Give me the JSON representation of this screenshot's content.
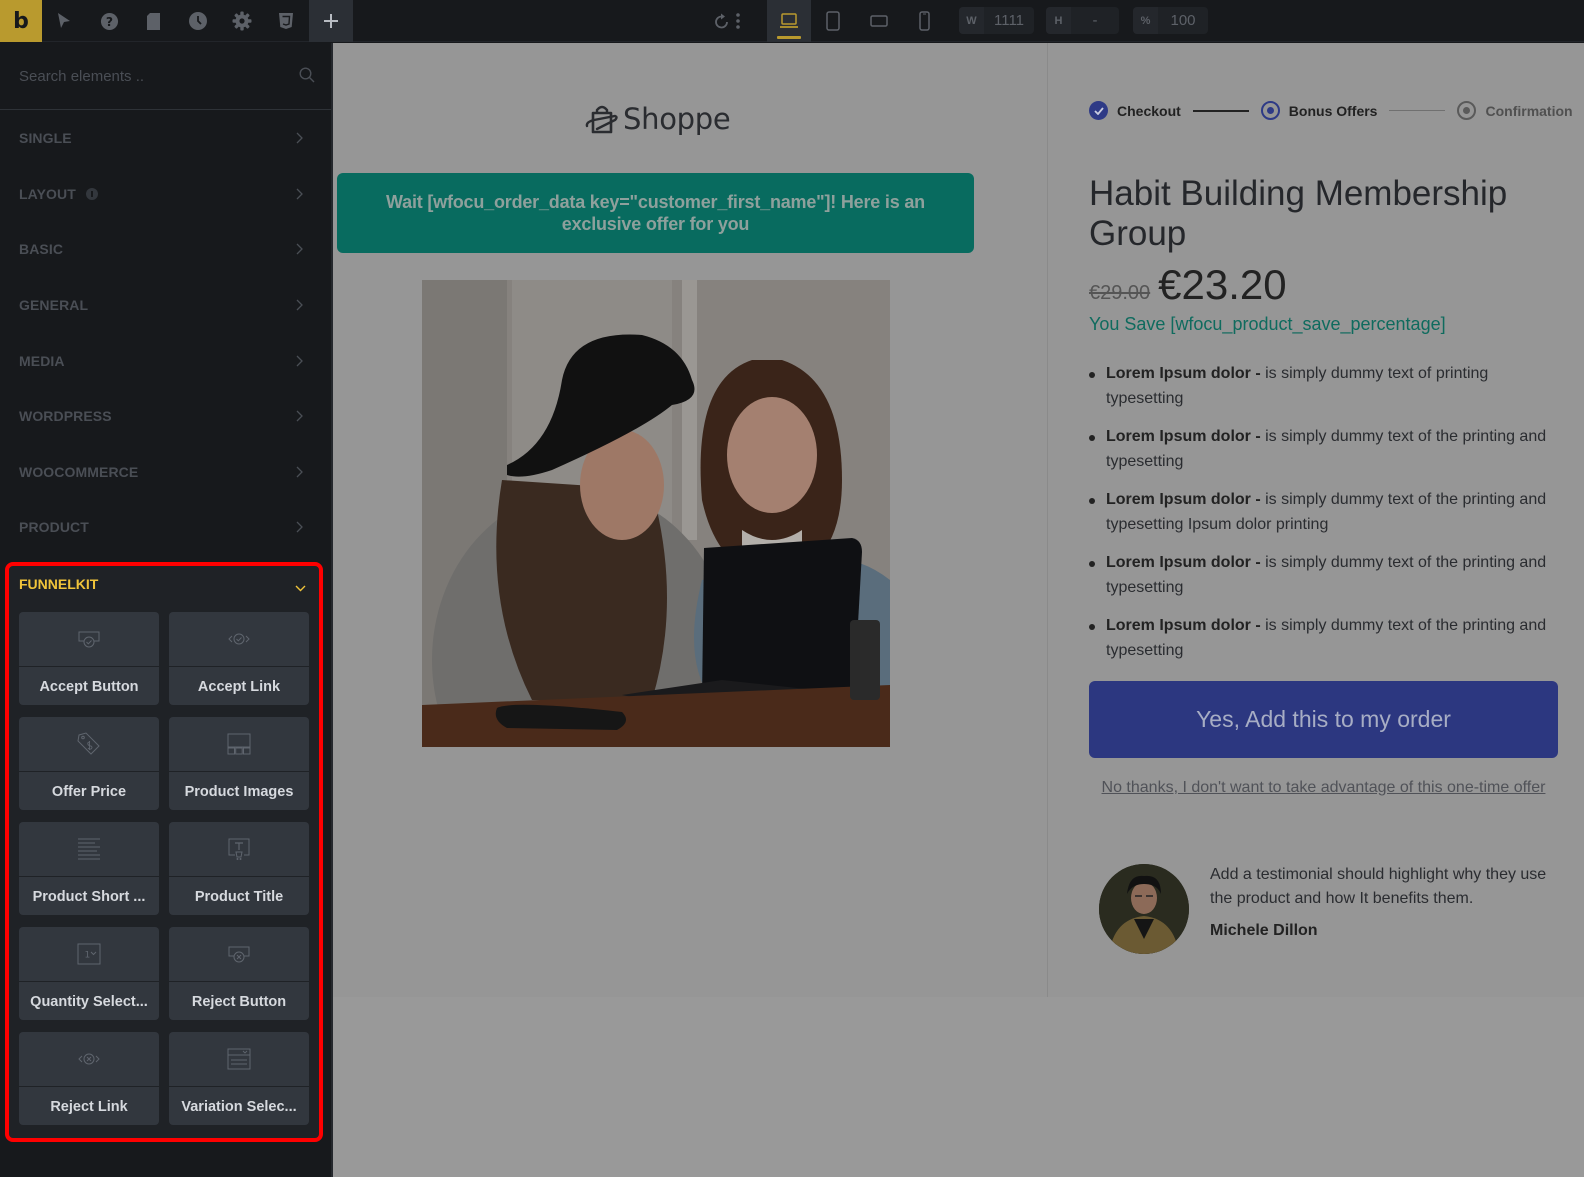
{
  "topbar": {
    "logo_letter": "b",
    "left_icons": [
      {
        "name": "pointer-icon"
      },
      {
        "name": "help-icon"
      },
      {
        "name": "page-icon"
      },
      {
        "name": "history-icon"
      },
      {
        "name": "settings-icon"
      },
      {
        "name": "css3-icon"
      }
    ],
    "add_label": "+",
    "devices": [
      {
        "name": "desktop",
        "active": true
      },
      {
        "name": "tablet-portrait",
        "active": false
      },
      {
        "name": "mobile-landscape",
        "active": false
      },
      {
        "name": "mobile-portrait",
        "active": false
      }
    ],
    "width": {
      "key": "W",
      "value": "1111"
    },
    "height": {
      "key": "H",
      "value": "-"
    },
    "zoom": {
      "key": "%",
      "value": "100"
    }
  },
  "sidebar": {
    "search_placeholder": "Search elements ..",
    "categories": [
      {
        "label": "SINGLE"
      },
      {
        "label": "LAYOUT",
        "info": true
      },
      {
        "label": "BASIC"
      },
      {
        "label": "GENERAL"
      },
      {
        "label": "MEDIA"
      },
      {
        "label": "WORDPRESS"
      },
      {
        "label": "WOOCOMMERCE"
      },
      {
        "label": "PRODUCT"
      }
    ],
    "funnelkit": {
      "label": "FUNNELKIT",
      "expanded": true,
      "elements": [
        {
          "label": "Accept Button",
          "icon": "accept-button-icon"
        },
        {
          "label": "Accept Link",
          "icon": "accept-link-icon"
        },
        {
          "label": "Offer Price",
          "icon": "price-tag-icon"
        },
        {
          "label": "Product Images",
          "icon": "product-images-icon"
        },
        {
          "label": "Product Short ...",
          "icon": "text-lines-icon"
        },
        {
          "label": "Product Title",
          "icon": "product-title-icon"
        },
        {
          "label": "Quantity Select...",
          "icon": "quantity-select-icon"
        },
        {
          "label": "Reject Button",
          "icon": "reject-button-icon"
        },
        {
          "label": "Reject Link",
          "icon": "reject-link-icon"
        },
        {
          "label": "Variation Selec...",
          "icon": "variation-select-icon"
        }
      ]
    }
  },
  "canvas": {
    "brand": "Shoppe",
    "banner": "Wait [wfocu_order_data key=\"customer_first_name\"]! Here is an exclusive offer for you",
    "steps": [
      {
        "label": "Checkout",
        "state": "done"
      },
      {
        "label": "Bonus Offers",
        "state": "active"
      },
      {
        "label": "Confirmation",
        "state": "todo"
      }
    ],
    "product_title": "Habit Building Membership Group",
    "price_old": "€29.00",
    "price_new": "€23.20",
    "save_text": "You Save [wfocu_product_save_percentage]",
    "bullets": [
      {
        "bold": "Lorem Ipsum dolor -",
        "text": " is simply dummy text of printing typesetting"
      },
      {
        "bold": "Lorem Ipsum dolor -",
        "text": " is simply dummy text of the printing and typesetting"
      },
      {
        "bold": "Lorem Ipsum dolor -",
        "text": " is simply dummy text of the printing and typesetting Ipsum dolor printing"
      },
      {
        "bold": "Lorem Ipsum dolor -",
        "text": " is simply dummy text of the printing and typesetting"
      },
      {
        "bold": "Lorem Ipsum dolor -",
        "text": " is simply dummy text of the printing and typesetting"
      }
    ],
    "accept_button": "Yes, Add this to my order",
    "reject_link": "No thanks, I don't want to take advantage of this one-time offer",
    "testimonial": {
      "text": "Add a testimonial should highlight why they use the product and how It benefits them.",
      "author": "Michele Dillon"
    }
  },
  "colors": {
    "brand_accent": "#b99a2e",
    "funnelkit_label": "#f0c43a",
    "highlight_border": "#ff0000",
    "banner_bg": "#086b5f",
    "cta_bg": "#2c3780",
    "save_text": "#0f6b5e"
  }
}
